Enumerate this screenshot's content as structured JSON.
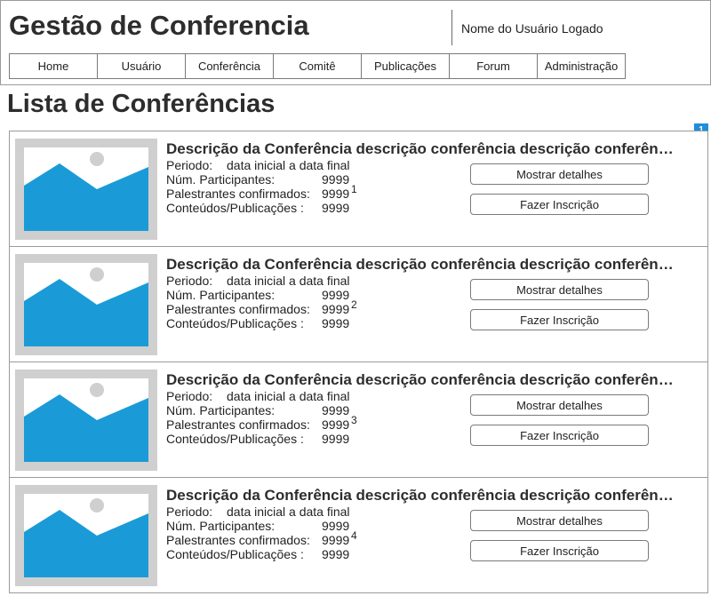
{
  "header": {
    "app_title": "Gestão de Conferencia",
    "user_name": "Nome do Usuário Logado"
  },
  "nav": {
    "items": [
      {
        "label": "Home"
      },
      {
        "label": "Usuário"
      },
      {
        "label": "Conferência"
      },
      {
        "label": "Comitê"
      },
      {
        "label": "Publicações"
      },
      {
        "label": "Forum"
      },
      {
        "label": "Administração"
      }
    ]
  },
  "page": {
    "title": "Lista de Conferências",
    "note_badge": "1"
  },
  "colors": {
    "image_placeholder_blue": "#1a9bd7",
    "image_placeholder_frame": "#cfcfcf",
    "note_badge": "#1f8edb"
  },
  "conferences": [
    {
      "description": "Descrição da Conferência descrição conferência descrição conferência",
      "period_label": "Periodo:",
      "period_value": "data inicial a data final",
      "participants_label": "Núm. Participantes:",
      "participants_value": "9999",
      "speakers_label": "Palestrantes confirmados:",
      "speakers_value": "9999",
      "marker": "1",
      "contents_label": "Conteúdos/Publicações :",
      "contents_value": "9999",
      "details_button": "Mostrar detalhes",
      "register_button": "Fazer Inscrição",
      "image_icon": "image-placeholder-icon"
    },
    {
      "description": "Descrição da Conferência descrição conferência descrição conferência",
      "period_label": "Periodo:",
      "period_value": "data inicial a data final",
      "participants_label": "Núm. Participantes:",
      "participants_value": "9999",
      "speakers_label": "Palestrantes confirmados:",
      "speakers_value": "9999",
      "marker": "2",
      "contents_label": "Conteúdos/Publicações :",
      "contents_value": "9999",
      "details_button": "Mostrar detalhes",
      "register_button": "Fazer Inscrição",
      "image_icon": "image-placeholder-icon"
    },
    {
      "description": "Descrição da Conferência descrição conferência descrição conferência",
      "period_label": "Periodo:",
      "period_value": "data inicial a data final",
      "participants_label": "Núm. Participantes:",
      "participants_value": "9999",
      "speakers_label": "Palestrantes confirmados:",
      "speakers_value": "9999",
      "marker": "3",
      "contents_label": "Conteúdos/Publicações :",
      "contents_value": "9999",
      "details_button": "Mostrar detalhes",
      "register_button": "Fazer Inscrição",
      "image_icon": "image-placeholder-icon"
    },
    {
      "description": "Descrição da Conferência descrição conferência descrição conferência",
      "period_label": "Periodo:",
      "period_value": "data inicial a data final",
      "participants_label": "Núm. Participantes:",
      "participants_value": "9999",
      "speakers_label": "Palestrantes confirmados:",
      "speakers_value": "9999",
      "marker": "4",
      "contents_label": "Conteúdos/Publicações :",
      "contents_value": "9999",
      "details_button": "Mostrar detalhes",
      "register_button": "Fazer Inscrição",
      "image_icon": "image-placeholder-icon"
    }
  ]
}
